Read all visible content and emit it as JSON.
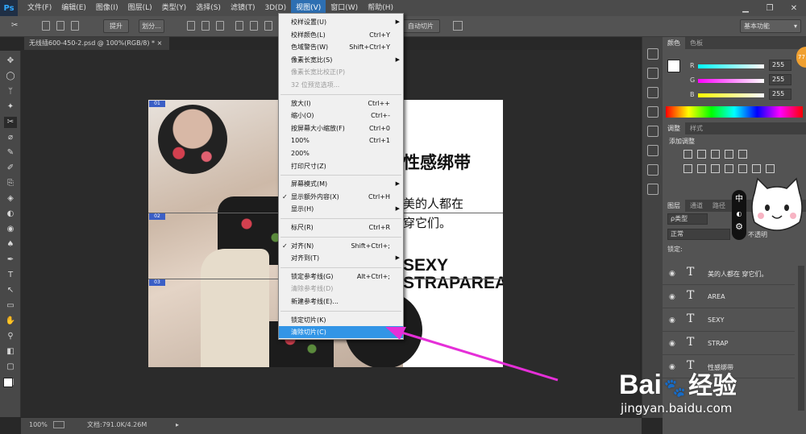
{
  "app": {
    "logo": "Ps"
  },
  "menubar": [
    "文件(F)",
    "编辑(E)",
    "图像(I)",
    "图层(L)",
    "类型(Y)",
    "选择(S)",
    "滤镜(T)",
    "3D(D)",
    "视图(V)",
    "窗口(W)",
    "帮助(H)"
  ],
  "options_bar": {
    "btn_promote": "提升",
    "btn_divide": "划分...",
    "btn_auto_slice": "自动切片",
    "workspace": "基本功能"
  },
  "document": {
    "tab_title": "无线插600-450-2.psd @ 100%(RGB/8) *",
    "slices": [
      "01",
      "02",
      "03"
    ],
    "heading": "性感绑带",
    "line1": "美的人都在",
    "line2": "穿它们。",
    "sexy": "SEXY",
    "strap": "STRAPAREA"
  },
  "statusbar": {
    "zoom": "100%",
    "doc_info": "文档:791.0K/4.26M"
  },
  "view_menu": {
    "items": [
      {
        "label": "校样设置(U)",
        "shortcut": "",
        "submenu": true
      },
      {
        "label": "校样颜色(L)",
        "shortcut": "Ctrl+Y"
      },
      {
        "label": "色域警告(W)",
        "shortcut": "Shift+Ctrl+Y"
      },
      {
        "label": "像素长宽比(S)",
        "shortcut": "",
        "submenu": true
      },
      {
        "label": "像素长宽比校正(P)",
        "shortcut": "",
        "disabled": true
      },
      {
        "label": "32 位预览选项...",
        "shortcut": "",
        "disabled": true
      },
      {
        "label": "放大(I)",
        "shortcut": "Ctrl++"
      },
      {
        "label": "缩小(O)",
        "shortcut": "Ctrl+-"
      },
      {
        "label": "按屏幕大小缩放(F)",
        "shortcut": "Ctrl+0"
      },
      {
        "label": "100%",
        "shortcut": "Ctrl+1"
      },
      {
        "label": "200%",
        "shortcut": ""
      },
      {
        "label": "打印尺寸(Z)",
        "shortcut": ""
      },
      {
        "label": "屏幕模式(M)",
        "shortcut": "",
        "submenu": true
      },
      {
        "label": "显示额外内容(X)",
        "shortcut": "Ctrl+H",
        "checked": true
      },
      {
        "label": "显示(H)",
        "shortcut": "",
        "submenu": true
      },
      {
        "label": "标尺(R)",
        "shortcut": "Ctrl+R"
      },
      {
        "label": "对齐(N)",
        "shortcut": "Shift+Ctrl+;",
        "checked": true
      },
      {
        "label": "对齐到(T)",
        "shortcut": "",
        "submenu": true
      },
      {
        "label": "锁定参考线(G)",
        "shortcut": "Alt+Ctrl+;"
      },
      {
        "label": "清除参考线(D)",
        "shortcut": "",
        "disabled": true
      },
      {
        "label": "新建参考线(E)...",
        "shortcut": ""
      },
      {
        "label": "锁定切片(K)",
        "shortcut": ""
      },
      {
        "label": "清除切片(C)",
        "shortcut": "",
        "highlighted": true
      }
    ]
  },
  "color_panel": {
    "tabs": [
      "颜色",
      "色板"
    ],
    "r": "255",
    "g": "255",
    "b": "255",
    "r_label": "R",
    "g_label": "G",
    "b_label": "B"
  },
  "adjust_panel": {
    "tabs": [
      "调整",
      "样式"
    ],
    "title": "添加调整"
  },
  "layers_panel": {
    "tabs": [
      "图层",
      "通道",
      "路径"
    ],
    "filter": "ρ类型",
    "blend": "正常",
    "opacity_label": "不透明",
    "lock_label": "锁定:",
    "layers": [
      "美的人都在 穿它们。",
      "AREA",
      "SEXY",
      "STRAP",
      "性感绑带"
    ]
  },
  "watermark": {
    "brand": "Bai",
    "suffix": "经验",
    "url": "jingyan.baidu.com"
  },
  "colors": {
    "menu_highlight": "#3295e6",
    "arrow": "#e52fd8",
    "slice_badge": "#3b5fc6"
  },
  "icons": [
    "ps-logo-icon",
    "minimize-icon",
    "maximize-icon",
    "close-icon",
    "eye-icon",
    "type-layer-icon",
    "arrow-pointer-icon",
    "cat-mascot-icon"
  ],
  "float_widget": {
    "label": "中"
  }
}
